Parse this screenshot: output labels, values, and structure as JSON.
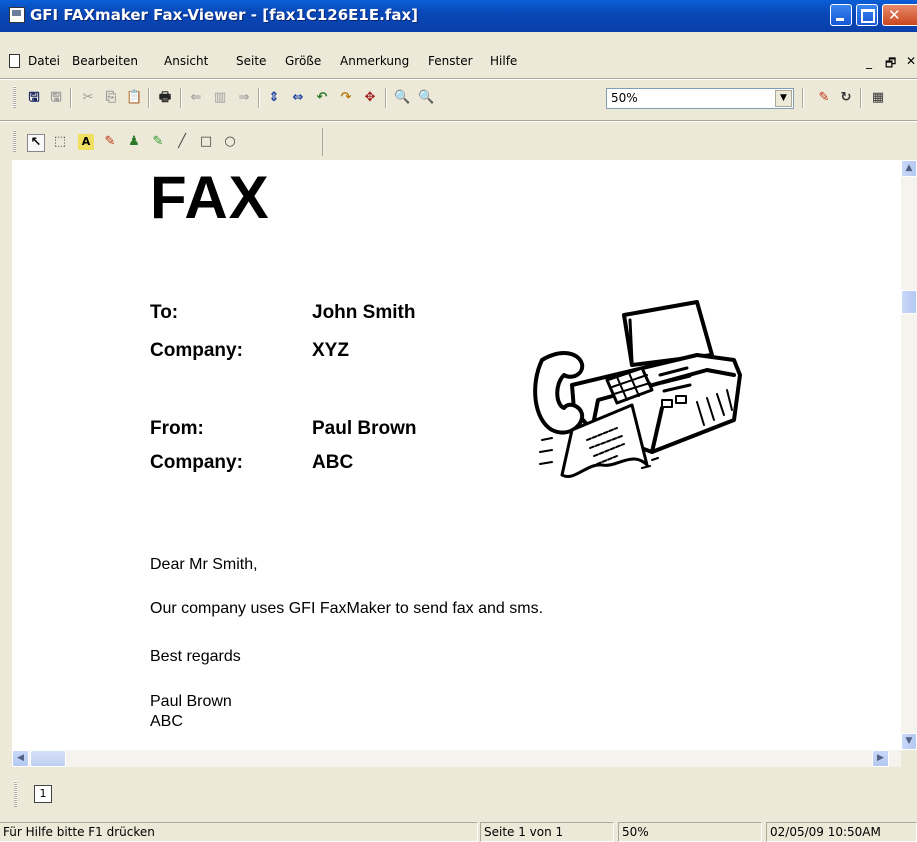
{
  "window": {
    "title": "GFI FAXmaker Fax-Viewer - [fax1C126E1E.fax]"
  },
  "menu": {
    "items": [
      "Datei",
      "Bearbeiten",
      "Ansicht",
      "Seite",
      "Größe",
      "Anmerkung",
      "Fenster",
      "Hilfe"
    ],
    "mdi_min": "_",
    "mdi_restore": "🗗",
    "mdi_close": "✕"
  },
  "toolbar": {
    "zoom_value": "50%"
  },
  "fax": {
    "title": "FAX",
    "to_label": "To:",
    "to_value": "John Smith",
    "to_company_label": "Company:",
    "to_company_value": "XYZ",
    "from_label": "From:",
    "from_value": "Paul Brown",
    "from_company_label": "Company:",
    "from_company_value": "ABC",
    "greeting": "Dear Mr Smith,",
    "body": "Our company uses GFI FaxMaker to send fax and sms.",
    "closing": "Best regards",
    "signature_name": "Paul Brown",
    "signature_company": "ABC"
  },
  "pages": {
    "tab_label": "1"
  },
  "status": {
    "help": "Für Hilfe bitte F1 drücken",
    "page": "Seite 1 von 1",
    "zoom": "50%",
    "datetime": "02/05/09 10:50AM"
  }
}
